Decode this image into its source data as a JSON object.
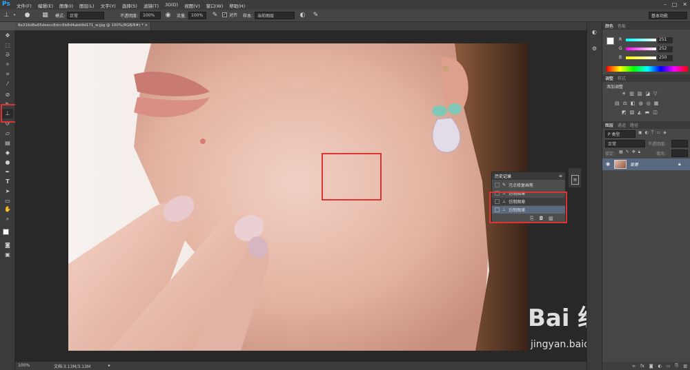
{
  "app": {
    "logo": "Ps"
  },
  "menu": [
    "文件(F)",
    "编辑(E)",
    "图像(I)",
    "图层(L)",
    "文字(Y)",
    "选择(S)",
    "滤镜(T)",
    "3D(D)",
    "视图(V)",
    "窗口(W)",
    "帮助(H)"
  ],
  "options": {
    "mode_label": "模式:",
    "mode_value": "正常",
    "opacity_label": "不透明度:",
    "opacity_value": "100%",
    "flow_label": "流量:",
    "flow_value": "100%",
    "aligned_label": "对齐",
    "sample_label": "样本:",
    "sample_value": "当前图层",
    "workspace": "基本功能"
  },
  "document": {
    "tab_title": "8e316d8a65deecc8dcc6b8d4abb9d171_w.jpg @ 100%(RGB/8#) *"
  },
  "status": {
    "zoom": "100%",
    "doc_info": "文档:3.13M/3.13M"
  },
  "color_panel": {
    "tabs": [
      "颜色",
      "色板"
    ],
    "r_label": "R",
    "r_value": "251",
    "g_label": "G",
    "g_value": "252",
    "b_label": "B",
    "b_value": "250"
  },
  "adjust_panel": {
    "tabs": [
      "调整",
      "样式"
    ],
    "add_label": "添加调整"
  },
  "layers_panel": {
    "tabs": [
      "图层",
      "通道",
      "路径"
    ],
    "filter": "P 类型",
    "blend": "正常",
    "opacity_label": "不透明度:",
    "lock_label": "锁定:",
    "fill_label": "填充:",
    "layer_name": "背景"
  },
  "history_panel": {
    "title": "历史记录",
    "items": [
      "污点修复画笔",
      "仿制图章",
      "仿制图章",
      "仿制图章"
    ]
  },
  "watermark": {
    "brand": "Bai 经验",
    "url": "jingyan.baidu.com"
  },
  "colors": {
    "highlight": "#e03434",
    "ps_blue": "#31a8ff"
  }
}
